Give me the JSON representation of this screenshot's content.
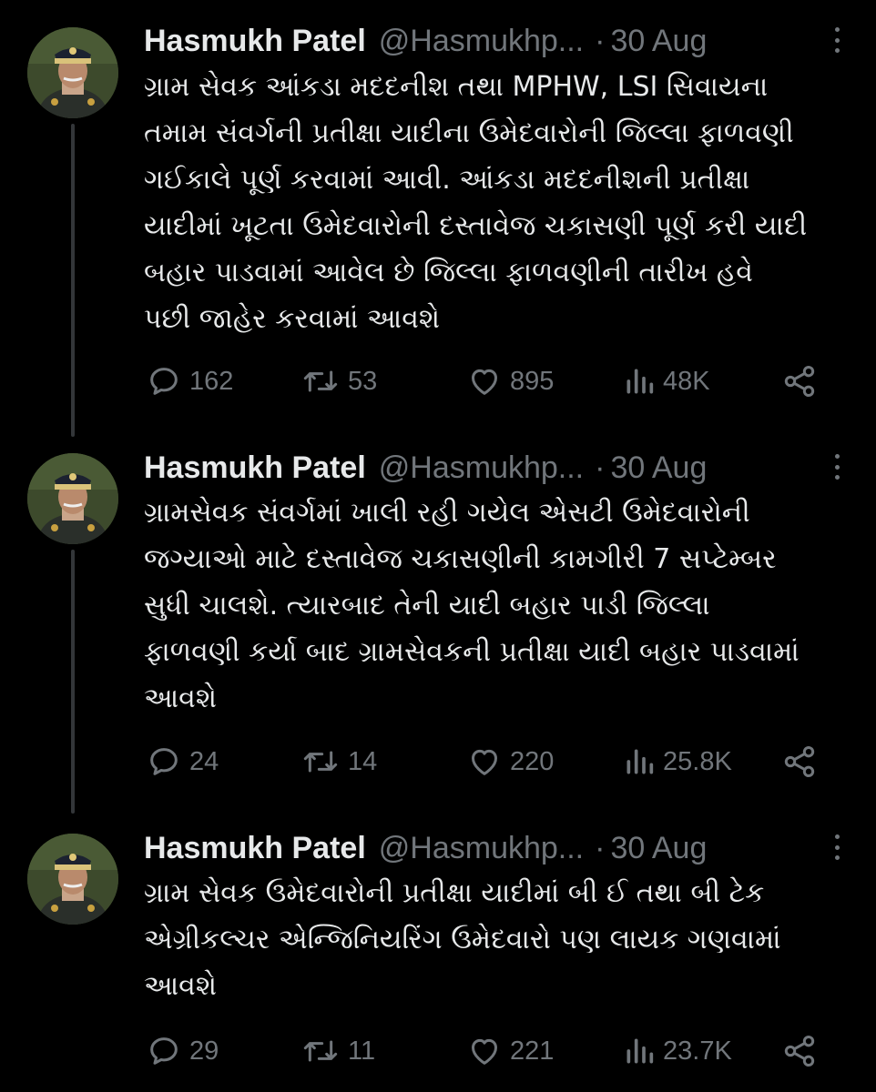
{
  "tweets": [
    {
      "author_name": "Hasmukh Patel",
      "handle": "@Hasmukhp...",
      "separator": "·",
      "time": "30 Aug",
      "text": "ગ્રામ સેવક આંકડા મદદનીશ તથા MPHW, LSI  સિવાયના\nતમામ સંવર્ગની પ્રતીક્ષા યાદીના ઉમેદવારોની જિલ્લા ફાળવણી\nગઈકાલે પૂર્ણ કરવામાં આવી. આંકડા મદદનીશની પ્રતીક્ષા\nયાદીમાં ખૂટતા ઉમેદવારોની દસ્તાવેજ ચકાસણી પૂર્ણ કરી યાદી\nબહાર પાડવામાં આવેલ છે જિલ્લા ફાળવણીની તારીખ હવે\nપછી જાહેર કરવામાં આવશે",
      "replies": "162",
      "reposts": "53",
      "likes": "895",
      "views": "48K"
    },
    {
      "author_name": "Hasmukh Patel",
      "handle": "@Hasmukhp...",
      "separator": "·",
      "time": "30 Aug",
      "text": "ગ્રામસેવક સંવર્ગમાં ખાલી રહી ગયેલ એસટી ઉમેદવારોની\nજગ્યાઓ માટે દસ્તાવેજ ચકાસણીની કામગીરી 7 સપ્ટેમ્બર\nસુધી ચાલશે. ત્યારબાદ તેની યાદી બહાર પાડી જિલ્લા\nફાળવણી કર્યા બાદ ગ્રામસેવકની પ્રતીક્ષા યાદી બહાર પાડવામાં\nઆવશે",
      "replies": "24",
      "reposts": "14",
      "likes": "220",
      "views": "25.8K"
    },
    {
      "author_name": "Hasmukh Patel",
      "handle": "@Hasmukhp...",
      "separator": "·",
      "time": "30 Aug",
      "text": "ગ્રામ સેવક ઉમેદવારોની પ્રતીક્ષા યાદીમાં બી ઈ તથા બી ટેક\nએગ્રીકલ્ચર એન્જિનિયરિંગ ઉમેદવારો પણ લાયક ગણવામાં\nઆવશે",
      "replies": "29",
      "reposts": "11",
      "likes": "221",
      "views": "23.7K"
    }
  ],
  "icons": {
    "reply": "reply-icon",
    "repost": "repost-icon",
    "like": "heart-icon",
    "views": "views-icon",
    "share": "share-icon",
    "more": "more-icon"
  },
  "colors": {
    "background": "#000000",
    "text": "#e7e9ea",
    "muted": "#71767b",
    "thread_line": "#333639"
  }
}
